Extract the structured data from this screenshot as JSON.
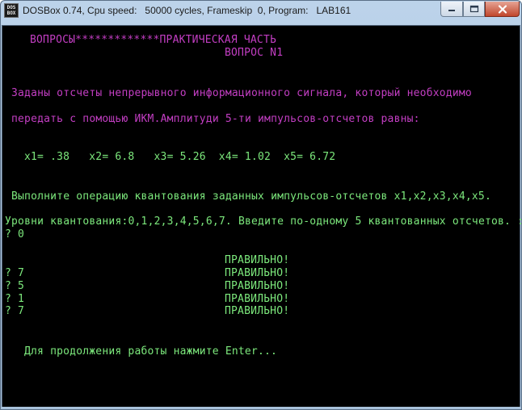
{
  "window": {
    "title": "DOSBox 0.74, Cpu speed:   50000 cycles, Frameskip  0, Program:   LAB161",
    "icon_text_top": "DOS",
    "icon_text_bottom": "BOX",
    "controls": [
      "minimize-icon",
      "maximize-icon",
      "close-icon"
    ]
  },
  "screen": {
    "header_line1": "ВОПРОСЫ*************ПРАКТИЧЕСКАЯ ЧАСТЬ",
    "header_line2": "ВОПРОС N1",
    "task_line1": "Заданы отсчеты непрерывного информационного сигнала, который необходимо",
    "task_line2": "передать с помощью ИКМ.Амплитуди 5-ти импульсов-отсчетов равны:",
    "values_line": "x1= .38   x2= 6.8   x3= 5.26  x4= 1.02  x5= 6.72",
    "instruction_line": "Выполните операцию квантования заданных импульсов-отсчетов x1,x2,x3,x4,x5.",
    "levels_line": "Уровни квантования:0,1,2,3,4,5,6,7. Введите по-одному 5 квантованных отсчетов. :",
    "answers": [
      {
        "input": "? 0",
        "result": ""
      },
      {
        "input": "",
        "result": "ПРАВИЛЬНО!"
      },
      {
        "input": "? 7",
        "result": "ПРАВИЛЬНО!"
      },
      {
        "input": "? 5",
        "result": "ПРАВИЛЬНО!"
      },
      {
        "input": "? 1",
        "result": "ПРАВИЛЬНО!"
      },
      {
        "input": "? 7",
        "result": "ПРАВИЛЬНО!"
      }
    ],
    "continue_prompt": "Для продолжения работы нажмите Enter..."
  },
  "colors": {
    "magenta_text": "#c33ec3",
    "green_text": "#7ce87c",
    "screen_background": "#000000"
  }
}
